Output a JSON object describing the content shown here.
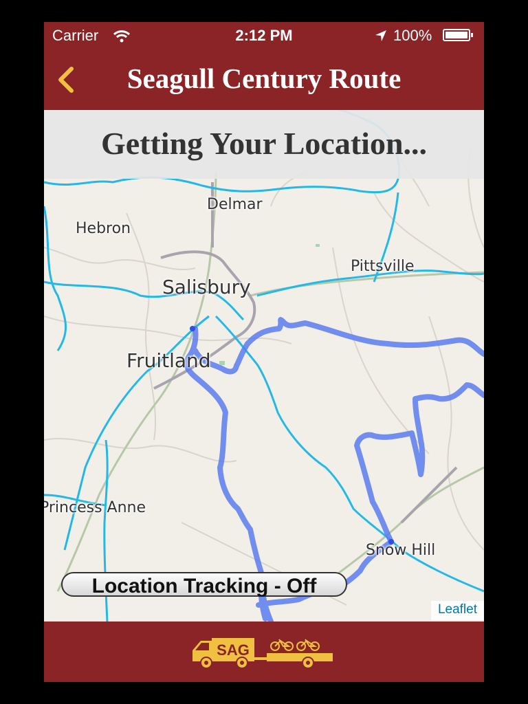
{
  "status_bar": {
    "carrier": "Carrier",
    "time": "2:12 PM",
    "battery": "100%",
    "battery_level": 1.0,
    "icons": [
      "wifi-icon",
      "location-arrow-icon",
      "battery-icon"
    ]
  },
  "nav": {
    "title": "Seagull Century Route",
    "back_icon": "chevron-left-icon"
  },
  "banner": {
    "text": "Getting Your Location..."
  },
  "map": {
    "places": [
      "Delmar",
      "Hebron",
      "Pittsville",
      "Salisbury",
      "Fruitland",
      "Princess Anne",
      "Snow Hill"
    ],
    "attribution": "Leaflet"
  },
  "tracking_button": {
    "label": "Location Tracking - Off"
  },
  "footer": {
    "logo_text": "SAG",
    "logo_icon": "sag-truck-bikes-icon"
  },
  "colors": {
    "brand": "#8b2427",
    "accent": "#f0c040",
    "route": "#5b7cf0",
    "water": "#22b8e8",
    "map_bg": "#f2efe9"
  }
}
